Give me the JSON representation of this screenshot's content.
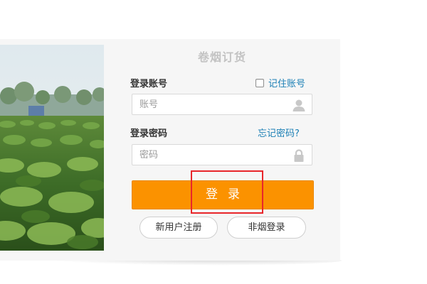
{
  "form": {
    "title": "卷烟订货",
    "account_label": "登录账号",
    "remember_label": "记住账号",
    "remember_checked": false,
    "account_placeholder": "账号",
    "account_value": "",
    "password_label": "登录密码",
    "forgot_label": "忘记密码?",
    "password_placeholder": "密码",
    "password_value": "",
    "login_label": "登录",
    "register_label": "新用户注册",
    "non_tobacco_label": "非烟登录"
  },
  "icons": {
    "account": "user-icon",
    "password": "lock-icon"
  },
  "colors": {
    "primary_button": "#fb9200",
    "link": "#1a7fb5",
    "highlight_box": "#e8262b",
    "title": "#c3c3c3"
  }
}
